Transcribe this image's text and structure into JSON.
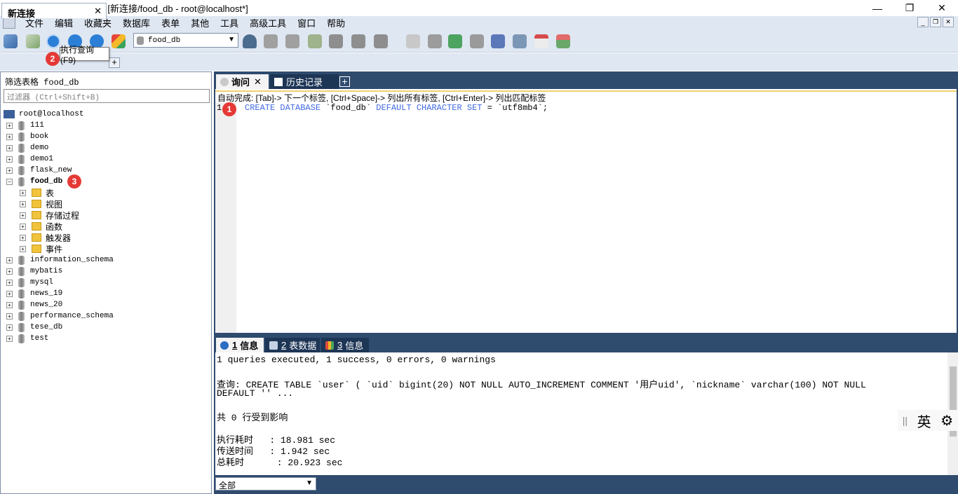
{
  "window": {
    "title": "SQLyog Ultimate 64 - [新连接/food_db - root@localhost*]",
    "minimize": "—",
    "maximize": "❐",
    "close": "✕"
  },
  "menu": [
    "文件",
    "编辑",
    "收藏夹",
    "数据库",
    "表单",
    "其他",
    "工具",
    "高级工具",
    "窗口",
    "帮助"
  ],
  "toolbar": {
    "database_select": "food_db",
    "tooltip": "执行查询 (F9)"
  },
  "badges": {
    "one": "1",
    "two": "2",
    "three": "3"
  },
  "connection_tab": {
    "label": "新连接",
    "close": "✕",
    "add": "+"
  },
  "object_browser": {
    "header": "筛选表格 food_db",
    "filter_placeholder": "过滤器 (Ctrl+Shift+B)",
    "root": "root@localhost",
    "databases": [
      "111",
      "book",
      "demo",
      "demo1",
      "flask_new",
      "food_db",
      "information_schema",
      "mybatis",
      "mysql",
      "news_19",
      "news_20",
      "performance_schema",
      "tese_db",
      "test"
    ],
    "food_db_children": [
      "表",
      "视图",
      "存储过程",
      "函数",
      "触发器",
      "事件"
    ]
  },
  "query_tabs": [
    {
      "label": "询问",
      "close": "✕"
    },
    {
      "label": "历史记录"
    }
  ],
  "editor": {
    "hint": "自动完成: [Tab]-> 下一个标签, [Ctrl+Space]-> 列出所有标签, [Ctrl+Enter]-> 列出匹配标签",
    "line_number": "1",
    "sql_kw1": "CREATE DATABASE",
    "sql_name": " `food_db` ",
    "sql_kw2": "DEFAULT CHARACTER SET",
    "sql_rest": " = `utf8mb4`;"
  },
  "result_tabs": [
    {
      "num": "1",
      "label": "信息"
    },
    {
      "num": "2",
      "label": "表数据"
    },
    {
      "num": "3",
      "label": "信息"
    }
  ],
  "results": {
    "summary": "1 queries executed, 1 success, 0 errors, 0 warnings",
    "query_line1": "查询: CREATE TABLE `user` ( `uid` bigint(20) NOT NULL AUTO_INCREMENT COMMENT '用户uid', `nickname` varchar(100) NOT NULL",
    "query_line2": "DEFAULT '' ...",
    "affected": "共 0 行受到影响",
    "exec_time": "执行耗时   : 18.981 sec",
    "transfer_time": "传送时间   : 1.942 sec",
    "total_time": "总耗时      : 20.923 sec"
  },
  "ime": {
    "lang": "英"
  },
  "bottom": {
    "filter": "全部"
  }
}
